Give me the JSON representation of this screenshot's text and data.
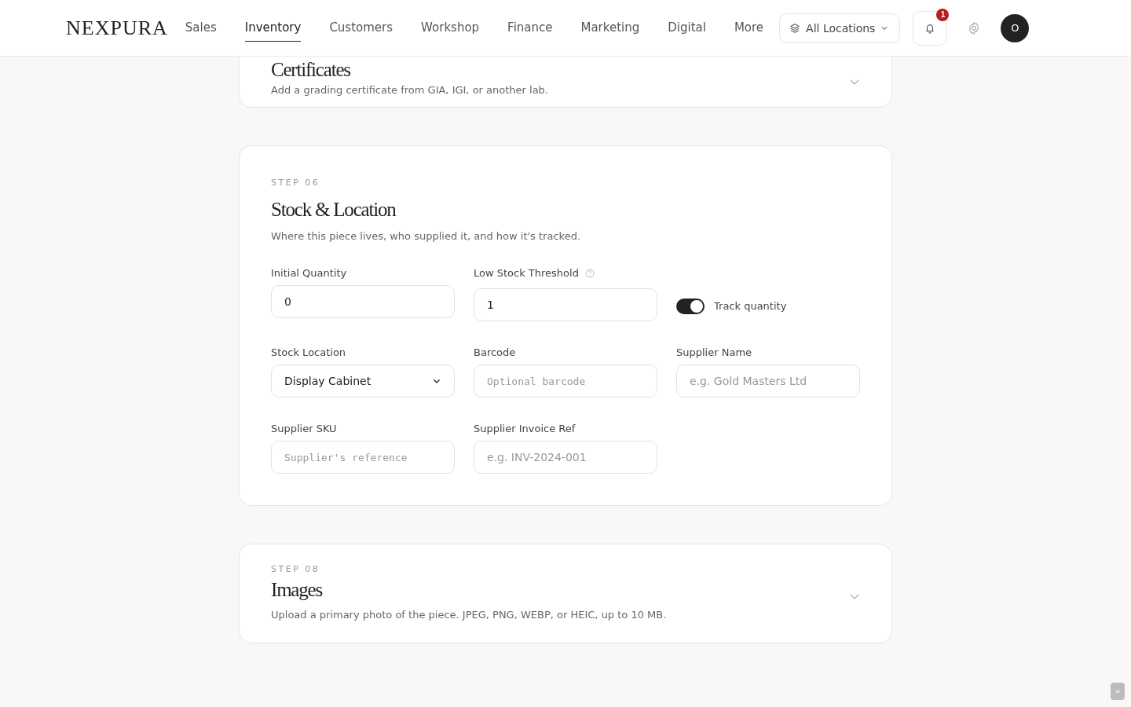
{
  "header": {
    "logo": "NEXPURA",
    "nav": [
      {
        "label": "Sales",
        "selected": false
      },
      {
        "label": "Inventory",
        "selected": true
      },
      {
        "label": "Customers",
        "selected": false
      },
      {
        "label": "Workshop",
        "selected": false
      },
      {
        "label": "Finance",
        "selected": false
      },
      {
        "label": "Marketing",
        "selected": false
      },
      {
        "label": "Digital",
        "selected": false
      },
      {
        "label": "More",
        "selected": false
      }
    ],
    "location_select": "All Locations",
    "notification_count": "1",
    "avatar": "O"
  },
  "sections": [
    {
      "kind": "collapsed",
      "title": "Certificates",
      "description": "Add a grading certificate from GIA, IGI, or another lab."
    },
    {
      "kind": "form",
      "step": "STEP 06",
      "title": "Stock & Location",
      "description": "Where this piece lives, who supplied it, and how it's tracked.",
      "fields": [
        {
          "kind": "input",
          "label": "Initial Quantity",
          "value": "0"
        },
        {
          "kind": "input",
          "label": "Low Stock Threshold",
          "value": "1",
          "help": true
        },
        {
          "kind": "toggle",
          "label": "Track quantity",
          "on": true
        },
        {
          "kind": "select",
          "label": "Stock Location",
          "value": "Display Cabinet"
        },
        {
          "kind": "input",
          "label": "Barcode",
          "placeholder": "Optional barcode",
          "mono": true
        },
        {
          "kind": "input",
          "label": "Supplier Name",
          "placeholder": "e.g. Gold Masters Ltd"
        },
        {
          "kind": "input",
          "label": "Supplier SKU",
          "placeholder": "Supplier's reference",
          "mono": true
        },
        {
          "kind": "input",
          "label": "Supplier Invoice Ref",
          "placeholder": "e.g. INV-2024-001"
        }
      ]
    },
    {
      "kind": "collapsed",
      "step": "STEP 08",
      "title": "Images",
      "description": "Upload a primary photo of the piece. JPEG, PNG, WEBP, or HEIC, up to 10 MB."
    }
  ]
}
